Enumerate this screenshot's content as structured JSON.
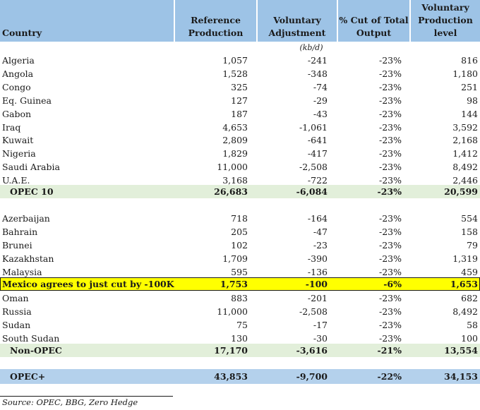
{
  "header": {
    "country": "Country",
    "reference": "Reference Production",
    "voluntary": "Voluntary Adjustment",
    "cut": "% Cut of Total Output",
    "proposed": "Proposed Voluntary Production level"
  },
  "unit_label": "(kb/d)",
  "opec_rows": [
    {
      "country": "Algeria",
      "ref": "1,057",
      "adj": "-241",
      "cut": "-23%",
      "proposed": "816"
    },
    {
      "country": "Angola",
      "ref": "1,528",
      "adj": "-348",
      "cut": "-23%",
      "proposed": "1,180"
    },
    {
      "country": "Congo",
      "ref": "325",
      "adj": "-74",
      "cut": "-23%",
      "proposed": "251"
    },
    {
      "country": "Eq. Guinea",
      "ref": "127",
      "adj": "-29",
      "cut": "-23%",
      "proposed": "98"
    },
    {
      "country": "Gabon",
      "ref": "187",
      "adj": "-43",
      "cut": "-23%",
      "proposed": "144"
    },
    {
      "country": "Iraq",
      "ref": "4,653",
      "adj": "-1,061",
      "cut": "-23%",
      "proposed": "3,592"
    },
    {
      "country": "Kuwait",
      "ref": "2,809",
      "adj": "-641",
      "cut": "-23%",
      "proposed": "2,168"
    },
    {
      "country": "Nigeria",
      "ref": "1,829",
      "adj": "-417",
      "cut": "-23%",
      "proposed": "1,412"
    },
    {
      "country": "Saudi Arabia",
      "ref": "11,000",
      "adj": "-2,508",
      "cut": "-23%",
      "proposed": "8,492"
    },
    {
      "country": "U.A.E.",
      "ref": "3,168",
      "adj": "-722",
      "cut": "-23%",
      "proposed": "2,446"
    }
  ],
  "opec_total": {
    "country": "OPEC 10",
    "ref": "26,683",
    "adj": "-6,084",
    "cut": "-23%",
    "proposed": "20,599"
  },
  "nonopec_rows_a": [
    {
      "country": "Azerbaijan",
      "ref": "718",
      "adj": "-164",
      "cut": "-23%",
      "proposed": "554"
    },
    {
      "country": "Bahrain",
      "ref": "205",
      "adj": "-47",
      "cut": "-23%",
      "proposed": "158"
    },
    {
      "country": "Brunei",
      "ref": "102",
      "adj": "-23",
      "cut": "-23%",
      "proposed": "79"
    },
    {
      "country": "Kazakhstan",
      "ref": "1,709",
      "adj": "-390",
      "cut": "-23%",
      "proposed": "1,319"
    },
    {
      "country": "Malaysia",
      "ref": "595",
      "adj": "-136",
      "cut": "-23%",
      "proposed": "459"
    }
  ],
  "mexico": {
    "country": "Mexico agrees to just cut by -100K",
    "ref": "1,753",
    "adj": "-100",
    "cut": "-6%",
    "proposed": "1,653"
  },
  "nonopec_rows_b": [
    {
      "country": "Oman",
      "ref": "883",
      "adj": "-201",
      "cut": "-23%",
      "proposed": "682"
    },
    {
      "country": "Russia",
      "ref": "11,000",
      "adj": "-2,508",
      "cut": "-23%",
      "proposed": "8,492"
    },
    {
      "country": "Sudan",
      "ref": "75",
      "adj": "-17",
      "cut": "-23%",
      "proposed": "58"
    },
    {
      "country": "South Sudan",
      "ref": "130",
      "adj": "-30",
      "cut": "-23%",
      "proposed": "100"
    }
  ],
  "nonopec_total": {
    "country": "Non-OPEC",
    "ref": "17,170",
    "adj": "-3,616",
    "cut": "-21%",
    "proposed": "13,554"
  },
  "grand_total": {
    "country": "OPEC+",
    "ref": "43,853",
    "adj": "-9,700",
    "cut": "-22%",
    "proposed": "34,153"
  },
  "source": "Source: OPEC, BBG, Zero Hedge",
  "colors": {
    "header_bg": "#9dc3e6",
    "subtotal_bg": "#e2efda",
    "highlight_bg": "#ffff00",
    "total_bg": "#b4d1ec"
  }
}
